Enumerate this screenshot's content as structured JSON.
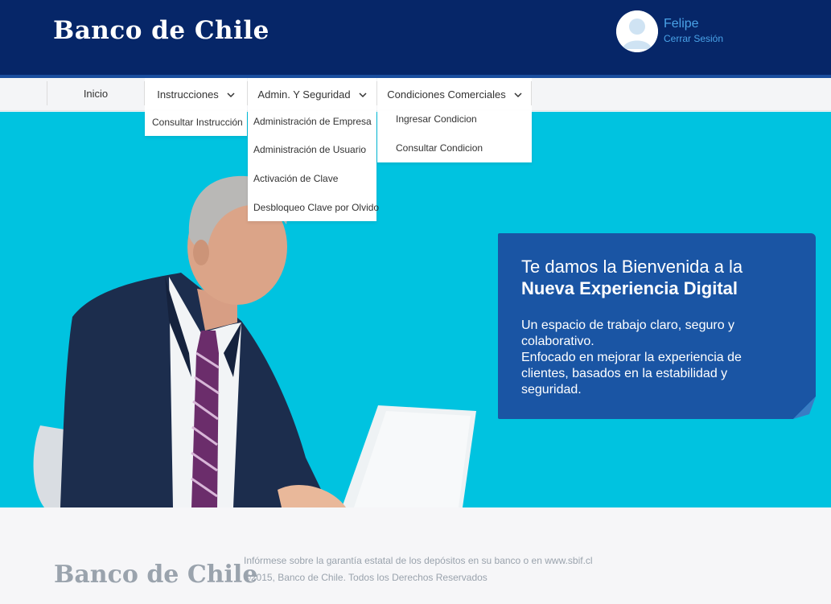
{
  "header": {
    "logo_text": "Banco de Chile",
    "user_name": "Felipe",
    "logout_label": "Cerrar Sesión"
  },
  "nav": {
    "items": [
      {
        "label": "Inicio",
        "has_dropdown": false
      },
      {
        "label": "Instrucciones",
        "has_dropdown": true
      },
      {
        "label": "Admin. Y Seguridad",
        "has_dropdown": true
      },
      {
        "label": "Condiciones Comerciales",
        "has_dropdown": true
      }
    ],
    "instrucciones_menu": [
      "Consultar Instrucción"
    ],
    "admin_menu": [
      "Administración de Empresa",
      "Administración de Usuario",
      "Activación de Clave",
      "Desbloqueo Clave por Olvido"
    ],
    "condiciones_menu": [
      "Ingresar Condicion",
      "Consultar Condicion"
    ]
  },
  "hero": {
    "title_line1": "Te damos la Bienvenida a la",
    "title_line2": "Nueva Experiencia Digital",
    "body_lines": [
      "Un espacio de trabajo claro, seguro y",
      "colaborativo.",
      "Enfocado en mejorar la experiencia de",
      "clientes, basados en la estabilidad y",
      "seguridad."
    ]
  },
  "footer": {
    "logo_text": "Banco de Chile",
    "deposit_notice": "Infórmese sobre la garantía estatal de los depósitos en su banco o en www.sbif.cl",
    "copyright": "©2015, Banco de Chile. Todos los Derechos Reservados"
  },
  "colors": {
    "header_bg": "#062668",
    "hero_bg": "#00c3e0",
    "welcome_bg": "#1a55a4",
    "link": "#4aa3e8"
  }
}
